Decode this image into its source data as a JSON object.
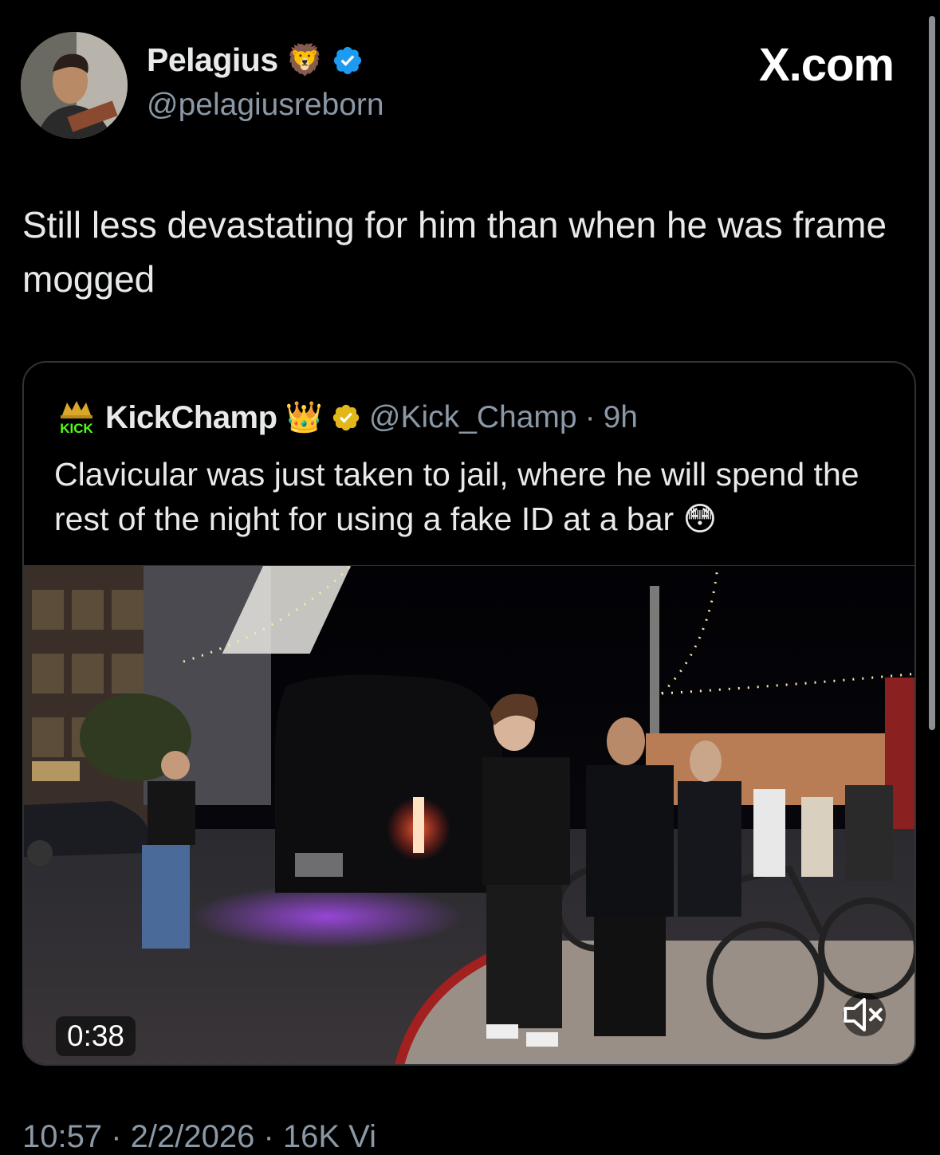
{
  "author": {
    "display_name": "Pelagius",
    "emoji": "🦁",
    "handle": "@pelagiusreborn",
    "verified_color": "#1d9bf0"
  },
  "site_label": "X.com",
  "tweet": {
    "text": "Still less devastating for him than when he was frame mogged"
  },
  "quote": {
    "logo_text": "KICK",
    "display_name": "KickChamp",
    "emoji": "👑",
    "verified_color": "#e2b719",
    "handle": "@Kick_Champ",
    "separator": "·",
    "time": "9h",
    "text": "Clavicular was just taken to jail, where he will spend the rest of the night for using a fake ID at a bar 😳",
    "video": {
      "duration": "0:38",
      "mute_icon": "speaker-muted-icon"
    }
  },
  "footer": {
    "meta": "10:57 · 2/2/2026 · 16K Vi"
  }
}
